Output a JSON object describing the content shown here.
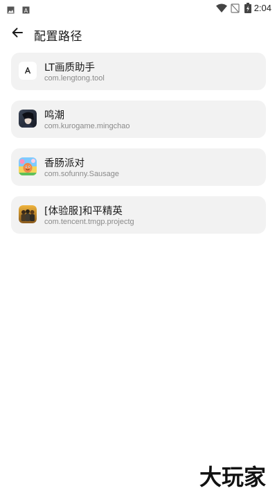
{
  "status_bar": {
    "time": "2:04",
    "left_icons": [
      "gallery-icon",
      "font-icon"
    ],
    "right_icons": [
      "wifi-icon",
      "no-signal-icon",
      "battery-charging-icon"
    ]
  },
  "header": {
    "title": "配置路径",
    "back_icon": "arrow-left-icon"
  },
  "apps": [
    {
      "name": "LT画质助手",
      "package": "com.lengtong.tool",
      "icon": "lt-app-icon"
    },
    {
      "name": "鸣潮",
      "package": "com.kurogame.mingchao",
      "icon": "mingchao-app-icon"
    },
    {
      "name": "香肠派对",
      "package": "com.sofunny.Sausage",
      "icon": "sausage-app-icon"
    },
    {
      "name": "[体验服]和平精英",
      "package": "com.tencent.tmgp.projectg",
      "icon": "pubg-app-icon"
    }
  ],
  "watermark": {
    "text": "大玩家"
  },
  "colors": {
    "card_bg": "#f2f2f2",
    "text_primary": "#1a1a1a",
    "text_secondary": "#8a8a8a"
  }
}
